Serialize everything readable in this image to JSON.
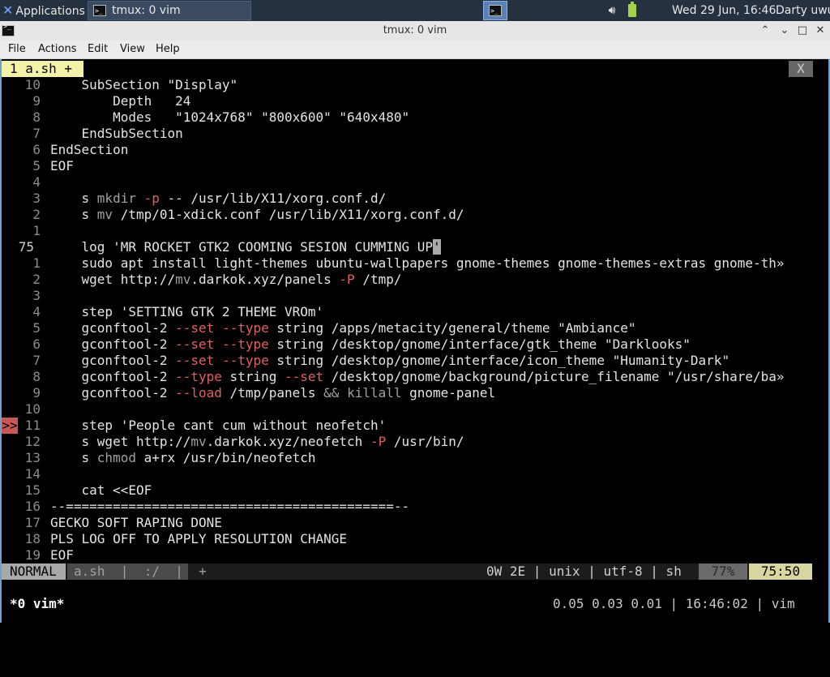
{
  "panel": {
    "applications_label": "Applications",
    "task_label": "tmux: 0 vim",
    "clock": "Wed 29 Jun, 16:46",
    "user": "Darty uwu",
    "volume_icon": "speaker-icon",
    "battery_icon": "battery-icon"
  },
  "window": {
    "title": "tmux: 0 vim",
    "buttons": {
      "up": "⌃",
      "minimize": "⌄",
      "maximize": "□",
      "close": "✕"
    }
  },
  "menu": [
    "File",
    "Actions",
    "Edit",
    "View",
    "Help"
  ],
  "vim": {
    "buffer_tab": "1 a.sh +",
    "buffer_close": "X",
    "lines": [
      {
        "n": "10",
        "text": "    SubSection \"Display\""
      },
      {
        "n": "9",
        "text": "        Depth   24"
      },
      {
        "n": "8",
        "text": "        Modes   \"1024x768\" \"800x600\" \"640x480\""
      },
      {
        "n": "7",
        "text": "    EndSubSection"
      },
      {
        "n": "6",
        "text": "EndSection"
      },
      {
        "n": "5",
        "text": "EOF"
      },
      {
        "n": "4",
        "text": ""
      },
      {
        "n": "3",
        "text": "    s mkdir -p -- /usr/lib/X11/xorg.conf.d/"
      },
      {
        "n": "2",
        "text": "    s mv /tmp/01-xdick.conf /usr/lib/X11/xorg.conf.d/"
      },
      {
        "n": "1",
        "text": ""
      },
      {
        "n": "75",
        "text": "    log 'MR ROCKET GTK2 COOMING SESION CUMMING UP'"
      },
      {
        "n": "1",
        "text": "    sudo apt install light-themes ubuntu-wallpapers gnome-themes gnome-themes-extras gnome-th»"
      },
      {
        "n": "2",
        "text": "    wget http://mv.darkok.xyz/panels -P /tmp/"
      },
      {
        "n": "3",
        "text": ""
      },
      {
        "n": "4",
        "text": "    step 'SETTING GTK 2 THEME VROm'"
      },
      {
        "n": "5",
        "text": "    gconftool-2 --set --type string /apps/metacity/general/theme \"Ambiance\""
      },
      {
        "n": "6",
        "text": "    gconftool-2 --set --type string /desktop/gnome/interface/gtk_theme \"Darklooks\""
      },
      {
        "n": "7",
        "text": "    gconftool-2 --set --type string /desktop/gnome/interface/icon_theme \"Humanity-Dark\""
      },
      {
        "n": "8",
        "text": "    gconftool-2 --type string --set /desktop/gnome/background/picture_filename \"/usr/share/ba»"
      },
      {
        "n": "9",
        "text": "    gconftool-2 --load /tmp/panels && killall gnome-panel"
      },
      {
        "n": "10",
        "text": ""
      },
      {
        "n": "11",
        "text": "    step 'People cant cum without neofetch'"
      },
      {
        "n": "12",
        "text": "    s wget http://mv.darkok.xyz/neofetch -P /usr/bin/"
      },
      {
        "n": "13",
        "text": "    s chmod a+rx /usr/bin/neofetch"
      },
      {
        "n": "14",
        "text": ""
      },
      {
        "n": "15",
        "text": "    cat <<EOF"
      },
      {
        "n": "16",
        "text": "--==========================================--"
      },
      {
        "n": "17",
        "text": "GECKO SOFT RAPING DONE"
      },
      {
        "n": "18",
        "text": "PLS LOG OFF TO APPLY RESOLUTION CHANGE"
      },
      {
        "n": "19",
        "text": "EOF"
      }
    ],
    "sign_marker": ">>",
    "status": {
      "mode": "NORMAL",
      "file": "a.sh  |  :/  |  +",
      "info": "0W 2E | unix | utf-8 | sh",
      "percent": "77%",
      "position": "75:50"
    }
  },
  "tmux": {
    "window": "*0 vim*",
    "right": "0.05 0.03 0.01 | 16:46:02 | vim"
  }
}
